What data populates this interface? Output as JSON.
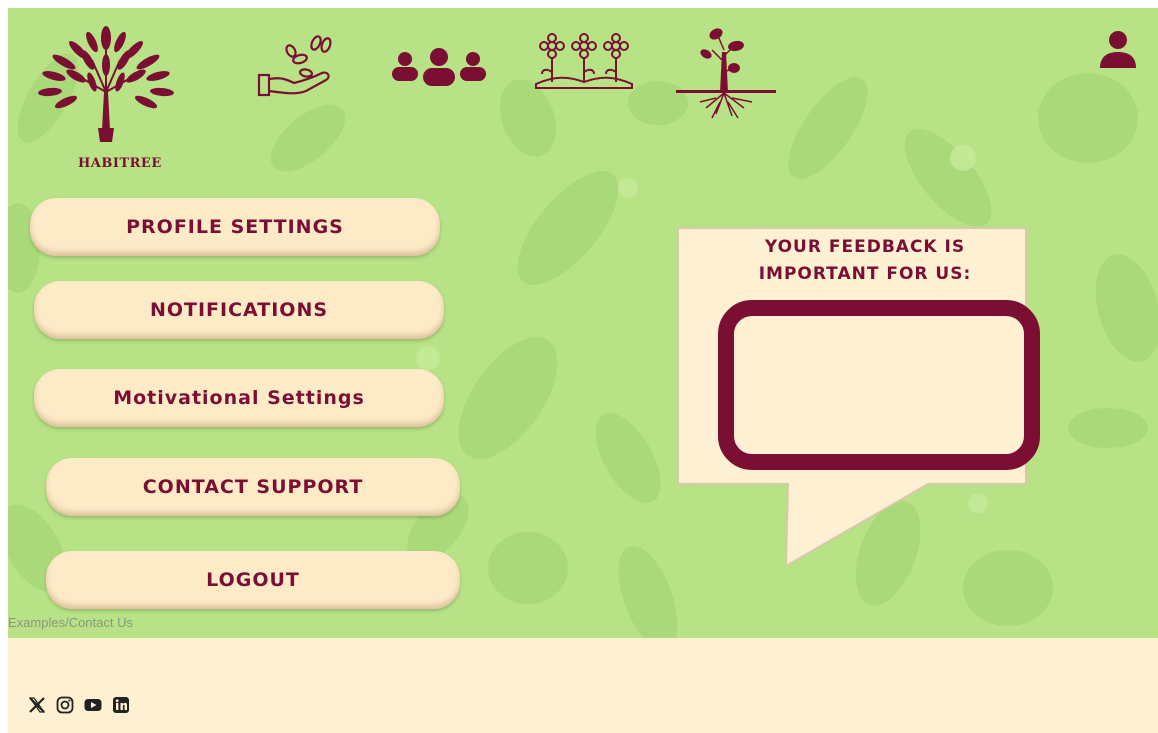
{
  "brand": {
    "name": "HABITREE"
  },
  "nav": {
    "icons": [
      "hand-seedling-icon",
      "community-icon",
      "flower-garden-icon",
      "tree-roots-icon"
    ],
    "profile_icon": "user-icon"
  },
  "menu": {
    "items": [
      {
        "label": "PROFILE SETTINGS"
      },
      {
        "label": "NOTIFICATIONS"
      },
      {
        "label": "Motivational Settings"
      },
      {
        "label": "CONTACT SUPPORT"
      },
      {
        "label": "LOGOUT"
      }
    ]
  },
  "feedback": {
    "title_line1": "YOUR FEEDBACK IS",
    "title_line2": "IMPORTANT FOR US:",
    "input_value": ""
  },
  "breadcrumb_link": "Examples/Contact Us",
  "footer": {
    "social_icons": [
      "x-icon",
      "instagram-icon",
      "youtube-icon",
      "linkedin-icon"
    ]
  },
  "colors": {
    "background": "#b7e386",
    "accent": "#7b0f33",
    "button_bg": "#fdebc8",
    "footer_bg": "#fdf0d3"
  }
}
